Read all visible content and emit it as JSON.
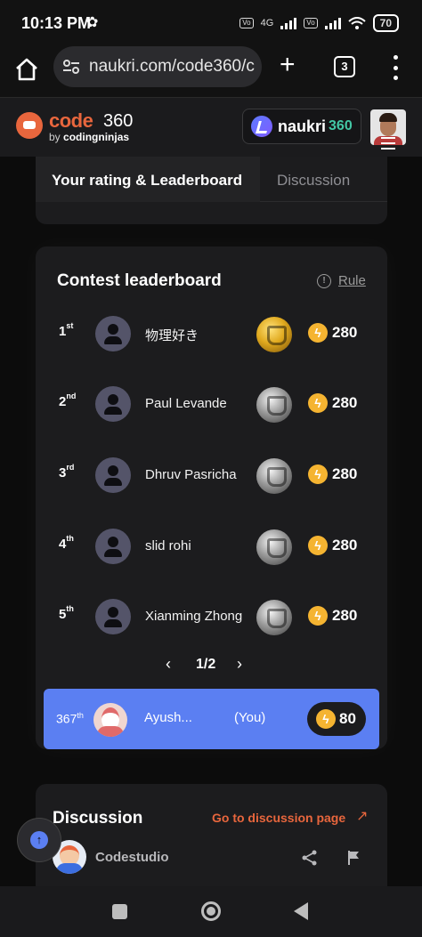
{
  "status_bar": {
    "time": "10:13 PM",
    "network": "4G",
    "battery": "70"
  },
  "browser": {
    "url": "naukri.com/code360/c",
    "tab_count": "3",
    "plus_label": "+"
  },
  "header": {
    "logo_code": "code",
    "logo_360": "360",
    "logo_by": "by",
    "logo_brand": "codingninjas",
    "naukri_label": "naukri",
    "naukri_360": "360"
  },
  "tabs": {
    "rating": "Your rating & Leaderboard",
    "discussion": "Discussion"
  },
  "leaderboard": {
    "title": "Contest leaderboard",
    "rule_label": "Rule",
    "rows": [
      {
        "rank": "1",
        "suffix": "st",
        "name": "物理好き",
        "score": "280",
        "trophy": "gold"
      },
      {
        "rank": "2",
        "suffix": "nd",
        "name": "Paul Levande",
        "score": "280",
        "trophy": "silver"
      },
      {
        "rank": "3",
        "suffix": "rd",
        "name": "Dhruv Pasricha",
        "score": "280",
        "trophy": "silver"
      },
      {
        "rank": "4",
        "suffix": "th",
        "name": "slid rohi",
        "score": "280",
        "trophy": "silver"
      },
      {
        "rank": "5",
        "suffix": "th",
        "name": "Xianming Zhong",
        "score": "280",
        "trophy": "silver"
      }
    ],
    "pager": "1/2",
    "you": {
      "rank": "367",
      "suffix": "th",
      "name": "Ayush...",
      "tag": "(You)",
      "score": "80"
    }
  },
  "discussion": {
    "title": "Discussion",
    "link": "Go to discussion page",
    "author": "Codestudio"
  },
  "colors": {
    "accent_orange": "#e8663d",
    "you_row_blue": "#5b7ff2",
    "coin_yellow": "#f5b431"
  }
}
